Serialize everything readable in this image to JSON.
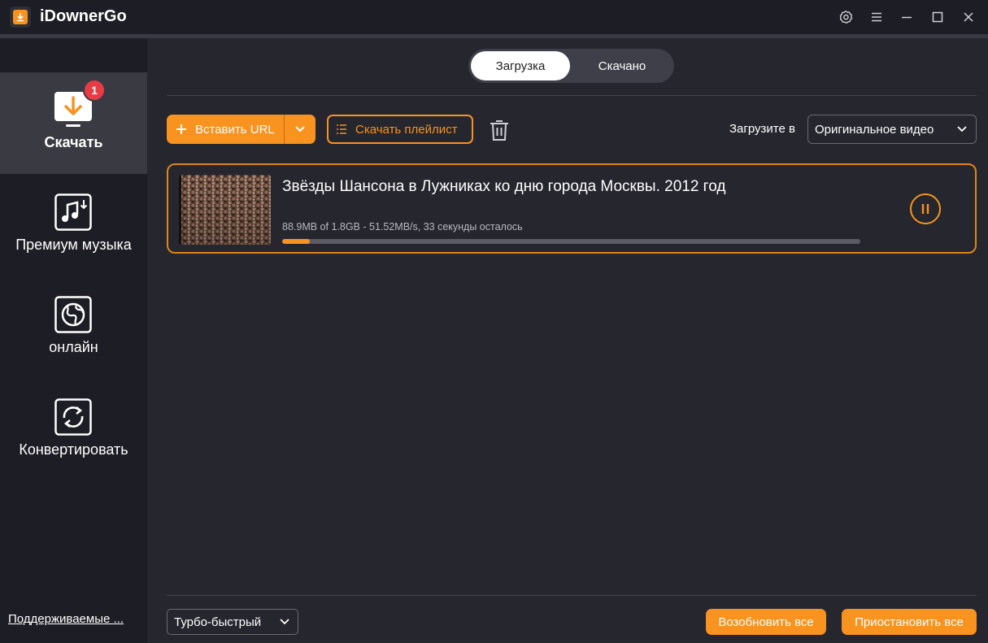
{
  "app": {
    "title": "iDownerGo"
  },
  "titlebar": {
    "buttons": [
      "settings-icon",
      "menu-icon",
      "minimize-icon",
      "maximize-icon",
      "close-icon"
    ]
  },
  "sidebar": {
    "items": [
      {
        "label": "Скачать",
        "icon": "download-icon",
        "active": true,
        "badge": "1"
      },
      {
        "label": "Премиум музыка",
        "icon": "music-download-icon",
        "active": false
      },
      {
        "label": "онлайн",
        "icon": "globe-icon",
        "active": false
      },
      {
        "label": "Конвертировать",
        "icon": "convert-icon",
        "active": false
      }
    ],
    "supported_link": "Поддерживаемые ..."
  },
  "tabs": {
    "downloading": "Загрузка",
    "downloaded": "Скачано"
  },
  "toolbar": {
    "paste_url": "Вставить URL",
    "download_playlist": "Скачать плейлист",
    "download_to_label": "Загрузите в",
    "format_value": "Оригинальное видео"
  },
  "download_item": {
    "title": "Звёзды Шансона в Лужниках ко дню города Москвы. 2012 год",
    "stats": "88.9MB of 1.8GB -   51.52MB/s, 33 секунды осталось",
    "progress_fraction": 0.048
  },
  "footer": {
    "speed_value": "Турбо-быстрый",
    "resume_all": "Возобновить все",
    "pause_all": "Приостановить все"
  },
  "colors": {
    "accent": "#f7931e",
    "badge": "#e83b44",
    "sidebar_bg": "#1d1d25",
    "main_bg": "#26262f"
  }
}
